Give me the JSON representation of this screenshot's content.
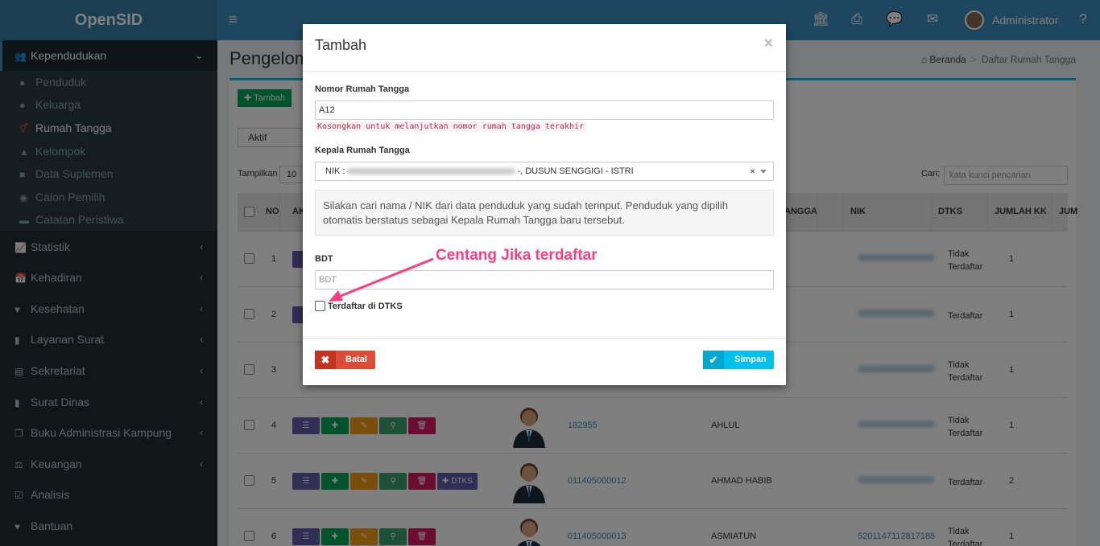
{
  "app": {
    "title": "OpenSID",
    "user": "Administrator"
  },
  "topbar": {
    "icons": [
      "menu-icon",
      "bank-icon",
      "print-icon",
      "chat-icon",
      "mail-icon",
      "help-icon"
    ]
  },
  "sidebar": {
    "items": [
      {
        "label": "Kependudukan",
        "icon": "users-icon",
        "active": true
      },
      {
        "label": "Statistik",
        "icon": "chart-icon"
      },
      {
        "label": "Kehadiran",
        "icon": "calendar-icon"
      },
      {
        "label": "Kesehatan",
        "icon": "heart-icon"
      },
      {
        "label": "Layanan Surat",
        "icon": "book-icon"
      },
      {
        "label": "Sekretariat",
        "icon": "archive-icon"
      },
      {
        "label": "Surat Dinas",
        "icon": "book-icon"
      },
      {
        "label": "Buku Administrasi Kampung",
        "icon": "copy-icon"
      },
      {
        "label": "Keuangan",
        "icon": "balance-icon"
      },
      {
        "label": "Analisis",
        "icon": "check-square-icon"
      },
      {
        "label": "Bantuan",
        "icon": "heart-icon"
      }
    ],
    "subitems": [
      {
        "label": "Penduduk",
        "icon": "user-icon"
      },
      {
        "label": "Keluarga",
        "icon": "users-icon"
      },
      {
        "label": "Rumah Tangga",
        "icon": "venus-mars-icon",
        "current": true
      },
      {
        "label": "Kelompok",
        "icon": "sitemap-icon"
      },
      {
        "label": "Data Suplemen",
        "icon": "save-icon"
      },
      {
        "label": "Calon Pemilih",
        "icon": "dribbble-icon"
      },
      {
        "label": "Catatan Peristiwa",
        "icon": "archive-icon"
      }
    ]
  },
  "page": {
    "title": "Pengelom",
    "breadcrumb": [
      "Beranda",
      "Daftar Rumah Tangga"
    ],
    "add_label": "Tambah",
    "filter_value": "Aktif",
    "show_label": "Tampilkan",
    "show_value": "10",
    "search_label": "Cari:",
    "search_placeholder": "kata kunci pencarian",
    "columns": [
      "NO",
      "AK",
      "ANGGA",
      "NIK",
      "DTKS",
      "JUMLAH KK",
      "JUM"
    ]
  },
  "rows": [
    {
      "no": "1",
      "nomor": "",
      "nama": "",
      "nik": "",
      "dtks": [
        "Tidak",
        "Terdaftar"
      ],
      "jkk": "1"
    },
    {
      "no": "2",
      "nomor": "",
      "nama": "",
      "nik": "",
      "dtks": [
        "Terdaftar"
      ],
      "jkk": "1"
    },
    {
      "no": "3",
      "nomor": "",
      "nama": "",
      "nik": "",
      "dtks": [
        "Tidak",
        "Terdaftar"
      ],
      "jkk": "1"
    },
    {
      "no": "4",
      "nomor": "182955",
      "nama": "AHLUL",
      "nik": "",
      "dtks": [
        "Tidak",
        "Terdaftar"
      ],
      "jkk": "1"
    },
    {
      "no": "5",
      "nomor": "011405000012",
      "nama": "AHMAD HABIB",
      "nik": "",
      "dtks": [
        "Terdaftar"
      ],
      "jkk": "2",
      "dtks_btn": "DTKS"
    },
    {
      "no": "6",
      "nomor": "011405000013",
      "nama": "ASMIATUN",
      "nik": "5201147112817188",
      "dtks": [
        "Tidak",
        "Terdaftar"
      ],
      "jkk": "1"
    }
  ],
  "modal": {
    "title": "Tambah",
    "close": "×",
    "nomor_label": "Nomor Rumah Tangga",
    "nomor_value": "A12",
    "nomor_hint": "Kosongkan untuk melanjutkan nomor rumah tangga terakhir",
    "kepala_label": "Kepala Rumah Tangga",
    "kepala_prefix": "NIK :",
    "kepala_suffix": "-, DUSUN SENGGIGI - ISTRI",
    "clear": "×",
    "info": "Silakan cari nama / NIK dari data penduduk yang sudah terinput. Penduduk yang dipilih otomatis berstatus sebagai Kepala Rumah Tangga baru tersebut.",
    "bdt_label": "BDT",
    "bdt_placeholder": "BDT",
    "dtks_checkbox_label": "Terdaftar di DTKS",
    "cancel_label": "Batal",
    "save_label": "Simpan"
  },
  "annotation": {
    "text": "Centang Jika terdaftar",
    "color": "#ff3d7f"
  },
  "colors": {
    "header": "#3c8dbc",
    "sidebar": "#222d32",
    "accent": "#00c0ef",
    "danger": "#dd4b39"
  }
}
